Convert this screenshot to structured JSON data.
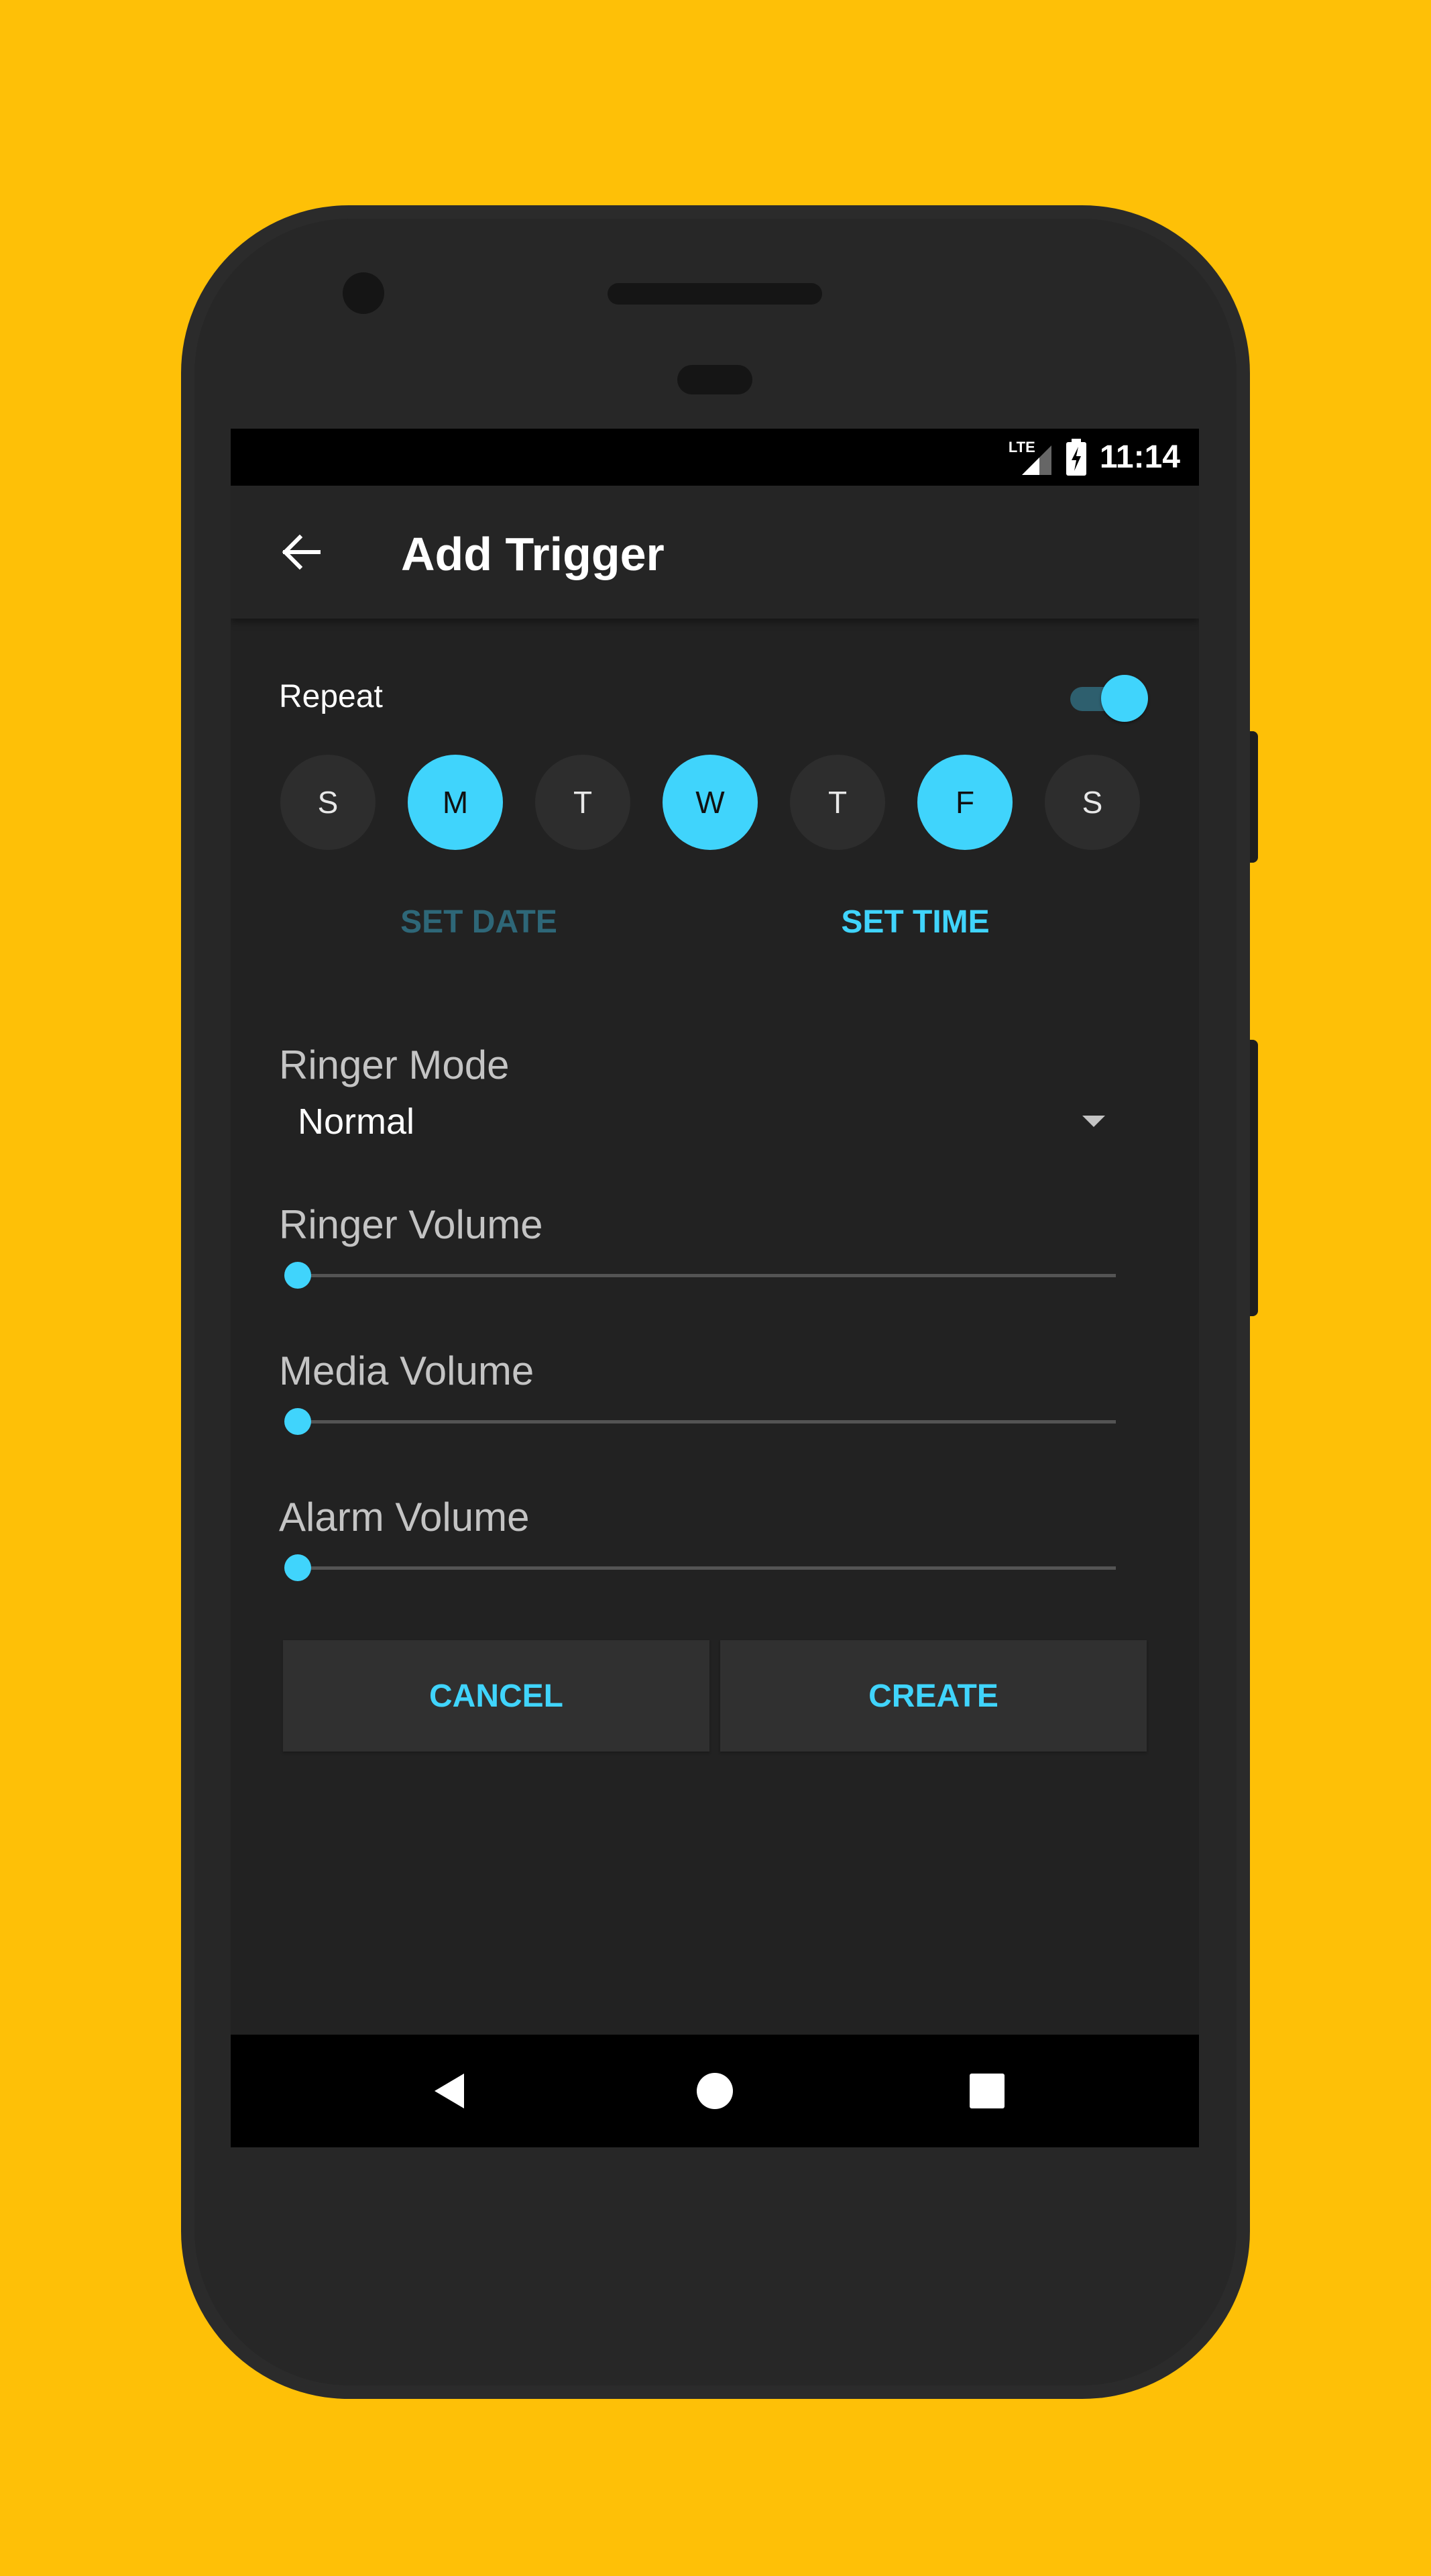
{
  "status_bar": {
    "time": "11:14",
    "network": "LTE",
    "icons": [
      "signal-icon",
      "battery-charging-icon"
    ]
  },
  "app_bar": {
    "title": "Add Trigger",
    "back_icon": "arrow-left-icon"
  },
  "repeat": {
    "label": "Repeat",
    "enabled": true,
    "days": [
      {
        "label": "S",
        "selected": false
      },
      {
        "label": "M",
        "selected": true
      },
      {
        "label": "T",
        "selected": false
      },
      {
        "label": "W",
        "selected": true
      },
      {
        "label": "T",
        "selected": false
      },
      {
        "label": "F",
        "selected": true
      },
      {
        "label": "S",
        "selected": false
      }
    ]
  },
  "buttons": {
    "set_date": "SET DATE",
    "set_time": "SET TIME",
    "cancel": "CANCEL",
    "create": "CREATE"
  },
  "ringer_mode": {
    "label": "Ringer Mode",
    "value": "Normal"
  },
  "sliders": [
    {
      "label": "Ringer Volume",
      "value": 0
    },
    {
      "label": "Media Volume",
      "value": 0
    },
    {
      "label": "Alarm Volume",
      "value": 0
    }
  ],
  "colors": {
    "accent": "#40D4FC",
    "background": "#FEC007",
    "screen": "#222222",
    "disabled_accent": "#2E6778"
  },
  "nav": [
    "back-icon",
    "home-icon",
    "recents-icon"
  ]
}
